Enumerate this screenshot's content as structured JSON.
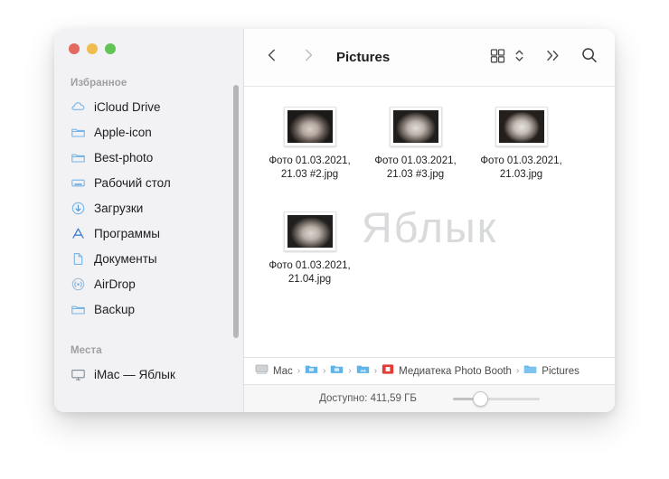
{
  "window": {
    "traffic_lights": [
      {
        "name": "close",
        "color": "#e4695e"
      },
      {
        "name": "minimize",
        "color": "#f0bc4f"
      },
      {
        "name": "maximize",
        "color": "#61c454"
      }
    ]
  },
  "sidebar": {
    "sections": [
      {
        "title": "Избранное",
        "items": [
          {
            "label": "iCloud Drive",
            "icon": "cloud-icon"
          },
          {
            "label": "Apple-icon",
            "icon": "folder-icon"
          },
          {
            "label": "Best-photo",
            "icon": "folder-icon"
          },
          {
            "label": "Рабочий стол",
            "icon": "desktop-icon"
          },
          {
            "label": "Загрузки",
            "icon": "downloads-icon"
          },
          {
            "label": "Программы",
            "icon": "applications-icon"
          },
          {
            "label": "Документы",
            "icon": "document-icon"
          },
          {
            "label": "AirDrop",
            "icon": "airdrop-icon"
          },
          {
            "label": "Backup",
            "icon": "folder-icon"
          }
        ]
      },
      {
        "title": "Места",
        "items": [
          {
            "label": "iMac — Яблык",
            "icon": "imac-icon"
          }
        ]
      }
    ]
  },
  "toolbar": {
    "back_icon": "chevron-left-icon",
    "forward_icon": "chevron-right-icon",
    "title": "Pictures",
    "view_icon": "grid-view-icon",
    "view_chevron_icon": "chevron-up-down-icon",
    "overflow_icon": "double-chevron-right-icon",
    "search_icon": "search-icon"
  },
  "files": {
    "rows": [
      [
        {
          "name": "Фото 01.03.2021, 21.03 #2.jpg",
          "thumb": "photo-thumbnail"
        },
        {
          "name": "Фото 01.03.2021, 21.03 #3.jpg",
          "thumb": "photo-thumbnail"
        },
        {
          "name": "Фото 01.03.2021, 21.03.jpg",
          "thumb": "photo-thumbnail"
        }
      ],
      [
        {
          "name": "Фото 01.03.2021, 21.04.jpg",
          "thumb": "photo-thumbnail"
        }
      ]
    ]
  },
  "watermark": {
    "text": "Яблык",
    "color": "#d8dadc"
  },
  "path_bar": {
    "crumbs": [
      {
        "label": "Mac",
        "icon": "hard-drive-icon"
      },
      {
        "label": "",
        "icon": "blue-folder-icon"
      },
      {
        "label": "",
        "icon": "blue-folder-icon"
      },
      {
        "label": "",
        "icon": "blue-folder-icon"
      },
      {
        "label": "Медиатека Photo Booth",
        "icon": "photo-booth-icon"
      },
      {
        "label": "Pictures",
        "icon": "blue-folder-icon"
      }
    ],
    "separator": "›"
  },
  "status_bar": {
    "available_text": "Доступно: 411,59 ГБ",
    "zoom_slider_value": 22
  }
}
